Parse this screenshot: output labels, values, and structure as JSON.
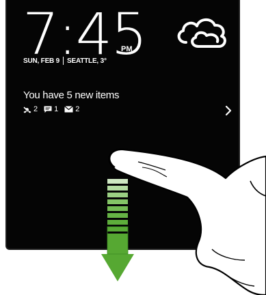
{
  "lockscreen": {
    "time": "7:45",
    "ampm": "PM",
    "date": "SUN, FEB 9",
    "location_temp": "SEATTLE, 3°",
    "weather_icon": "cloudy-icon",
    "notification": {
      "title": "You have 5 new items",
      "missed_calls_count": "2",
      "messages_count": "1",
      "emails_count": "2"
    }
  },
  "colors": {
    "screen_bg": "#050505",
    "text": "#ffffff",
    "arrow_green": "#56a832",
    "arrow_green_dark": "#3d8b25"
  }
}
